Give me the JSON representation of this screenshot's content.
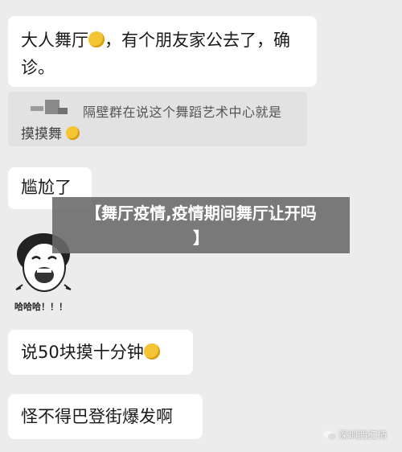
{
  "messages": [
    {
      "text_before": "大人舞厅",
      "text_after": "，有个朋友家公去了，确诊。"
    },
    {
      "text": "尴尬了"
    },
    {
      "text": "说50块摸十分钟"
    },
    {
      "text": "怪不得巴登街爆发啊"
    }
  ],
  "quote": {
    "line1": "隔壁群在说这个舞蹈艺术中心就是",
    "line2": "摸摸舞"
  },
  "emoji_icon": "face-with-tears-of-joy-icon",
  "banner": {
    "line1": "【舞厅疫情,疫情期间舞厅让开吗",
    "line2": "】"
  },
  "meme": {
    "caption": "哈哈哈！！！"
  },
  "watermark": {
    "label": "深圳西红柿"
  },
  "colors": {
    "background": "#ececec",
    "bubble": "#ffffff",
    "quote_bg": "#e2e2e2",
    "banner_bg": "#696969"
  }
}
